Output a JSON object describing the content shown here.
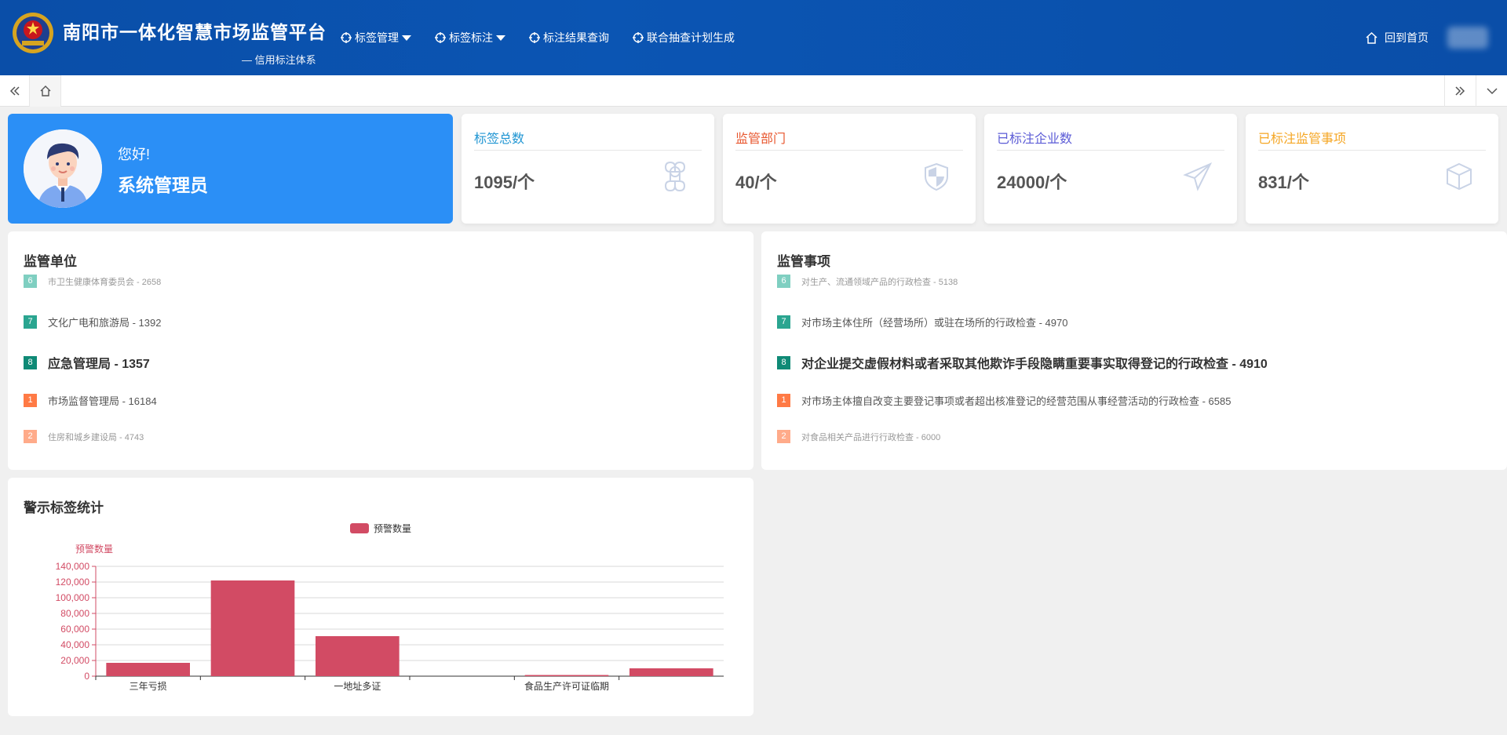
{
  "header": {
    "title": "南阳市一体化智慧市场监管平台",
    "subtitle": "— 信用标注体系",
    "nav": [
      {
        "label": "标签管理",
        "has_dropdown": true
      },
      {
        "label": "标签标注",
        "has_dropdown": true
      },
      {
        "label": "标注结果查询",
        "has_dropdown": false
      },
      {
        "label": "联合抽查计划生成",
        "has_dropdown": false
      }
    ],
    "home_label": "回到首页"
  },
  "welcome": {
    "greeting": "您好!",
    "name": "系统管理员",
    "color": "#2b8ff6"
  },
  "stats": [
    {
      "title": "标签总数",
      "value": "1095/个",
      "color": "#2196d3",
      "icon": "command-icon"
    },
    {
      "title": "监管部门",
      "value": "40/个",
      "color": "#e8572f",
      "icon": "shield-icon"
    },
    {
      "title": "已标注企业数",
      "value": "24000/个",
      "color": "#5b5bd6",
      "icon": "send-icon"
    },
    {
      "title": "已标注监管事项",
      "value": "831/个",
      "color": "#f5a623",
      "icon": "box-icon"
    }
  ],
  "units_panel": {
    "title": "监管单位",
    "items": [
      {
        "rank": "6",
        "text": "市卫生健康体育委员会 - 2658"
      },
      {
        "rank": "7",
        "text": "文化广电和旅游局 - 1392"
      },
      {
        "rank": "8",
        "text": "应急管理局 - 1357"
      },
      {
        "rank": "1",
        "text": "市场监督管理局 - 16184"
      },
      {
        "rank": "2",
        "text": "住房和城乡建设局 - 4743"
      }
    ]
  },
  "matters_panel": {
    "title": "监管事项",
    "items": [
      {
        "rank": "6",
        "text": "对生产、流通领域产品的行政检查 - 5138"
      },
      {
        "rank": "7",
        "text": "对市场主体住所（经营场所）或驻在场所的行政检查 - 4970"
      },
      {
        "rank": "8",
        "text": "对企业提交虚假材料或者采取其他欺诈手段隐瞒重要事实取得登记的行政检查 - 4910"
      },
      {
        "rank": "1",
        "text": "对市场主体擅自改变主要登记事项或者超出核准登记的经营范围从事经营活动的行政检查 - 6585"
      },
      {
        "rank": "2",
        "text": "对食品相关产品进行行政检查 - 6000"
      }
    ]
  },
  "warning_panel": {
    "title": "警示标签统计"
  },
  "chart_data": {
    "type": "bar",
    "legend": [
      "预警数量"
    ],
    "legend_position": "top-center",
    "ylabel": "预警数量",
    "ylim": [
      0,
      140000
    ],
    "yticks": [
      "0",
      "20,000",
      "40,000",
      "60,000",
      "80,000",
      "100,000",
      "120,000",
      "140,000"
    ],
    "categories": [
      "三年亏损",
      "",
      "一地址多证",
      "",
      "食品生产许可证临期",
      ""
    ],
    "series": [
      {
        "name": "预警数量",
        "values": [
          17000,
          122000,
          51000,
          0,
          1500,
          10000
        ]
      }
    ],
    "bar_color": "#d24b64",
    "axis_color": "#d24b64",
    "grid": true
  }
}
